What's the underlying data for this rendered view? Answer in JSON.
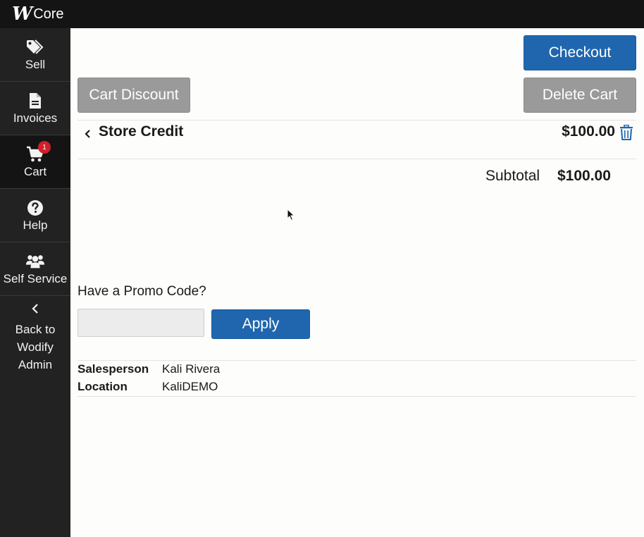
{
  "app": {
    "logo_mark": "W",
    "logo_text": "Core"
  },
  "sidebar": {
    "items": [
      {
        "label": "Sell",
        "icon": "tag-icon"
      },
      {
        "label": "Invoices",
        "icon": "file-icon"
      },
      {
        "label": "Cart",
        "icon": "cart-icon",
        "badge": "1",
        "active": true
      },
      {
        "label": "Help",
        "icon": "question-icon"
      },
      {
        "label": "Self Service",
        "icon": "users-icon"
      }
    ],
    "back": {
      "line1": "Back to",
      "line2": "Wodify",
      "line3": "Admin",
      "icon": "chevron-left-icon"
    }
  },
  "actions": {
    "checkout_label": "Checkout",
    "cart_discount_label": "Cart Discount",
    "delete_cart_label": "Delete Cart"
  },
  "cart": {
    "items": [
      {
        "name": "Store Credit",
        "price": "$100.00"
      }
    ],
    "subtotal_label": "Subtotal",
    "subtotal_value": "$100.00"
  },
  "promo": {
    "heading": "Have a Promo Code?",
    "value": "",
    "placeholder": "",
    "apply_label": "Apply"
  },
  "info": {
    "salesperson_label": "Salesperson",
    "salesperson_value": "Kali Rivera",
    "location_label": "Location",
    "location_value": "KaliDEMO"
  },
  "colors": {
    "primary": "#1f66ae",
    "secondary_button": "#9a9a9a",
    "sidebar_bg": "#222222",
    "topbar_bg": "#141414",
    "badge": "#d0202a"
  }
}
